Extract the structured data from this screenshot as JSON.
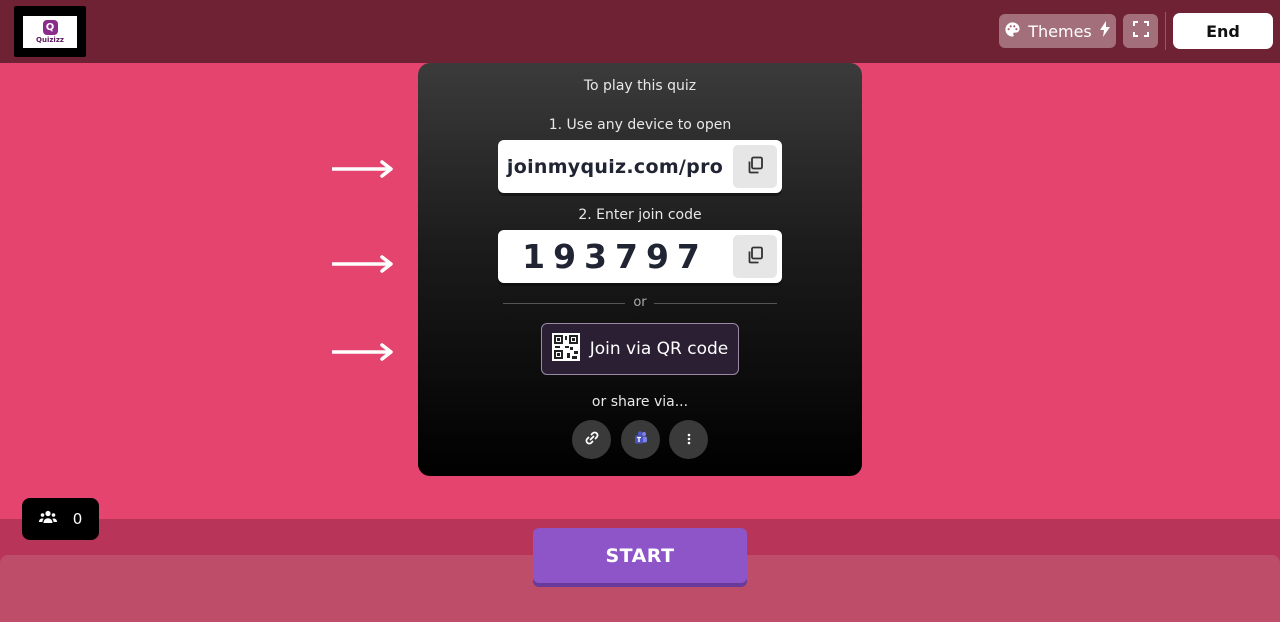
{
  "header": {
    "logo_text": "Quizizz",
    "themes_label": "Themes",
    "end_label": "End"
  },
  "card": {
    "heading": "To play this quiz",
    "step1_label": "1. Use any device to open",
    "join_url": "joinmyquiz.com/pro",
    "step2_label": "2. Enter join code",
    "join_code": "193797",
    "or_label": "or",
    "qr_label": "Join via QR code",
    "share_label": "or share via..."
  },
  "players": {
    "count": "0"
  },
  "footer": {
    "start_label": "START"
  },
  "colors": {
    "background": "#e5446e",
    "topbar": "#702235",
    "start_button": "#8e55c8"
  }
}
